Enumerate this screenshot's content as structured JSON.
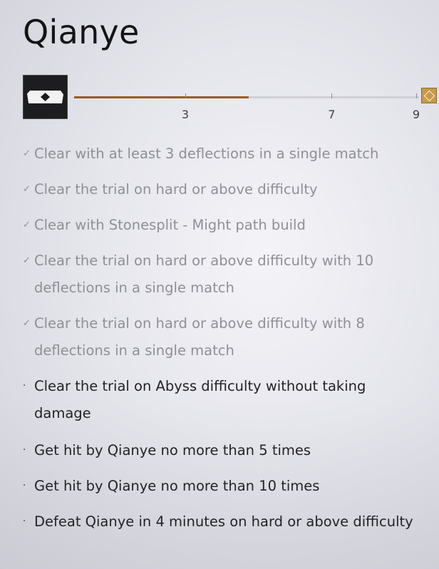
{
  "header": {
    "title": "Qianye"
  },
  "progress": {
    "completed": 5,
    "total": 9,
    "thresholds": [
      {
        "value": 3,
        "label": "3"
      },
      {
        "value": 7,
        "label": "7"
      },
      {
        "value": 9,
        "label": "9"
      }
    ],
    "fill_color": "#9a5b22",
    "icon": "boss-mask-icon",
    "reward_icon": "reward-gem-icon"
  },
  "challenges": [
    {
      "text": "Clear with at least 3 deflections in a single match",
      "completed": true
    },
    {
      "text": "Clear the trial on hard or above difficulty",
      "completed": true
    },
    {
      "text": "Clear with Stonesplit - Might path build",
      "completed": true
    },
    {
      "text": "Clear the trial on hard or above difficulty with 10 deflections in a single match",
      "completed": true
    },
    {
      "text": "Clear the trial on hard or above difficulty with 8 deflections in a single match",
      "completed": true
    },
    {
      "text": "Clear the trial on Abyss difficulty without taking damage",
      "completed": false
    },
    {
      "text": "Get hit by Qianye no more than 5 times",
      "completed": false
    },
    {
      "text": "Get hit by Qianye no more than 10 times",
      "completed": false
    },
    {
      "text": "Defeat Qianye in 4 minutes on hard or above difficulty",
      "completed": false
    }
  ],
  "marks": {
    "completed": "✓",
    "incomplete": "·"
  }
}
